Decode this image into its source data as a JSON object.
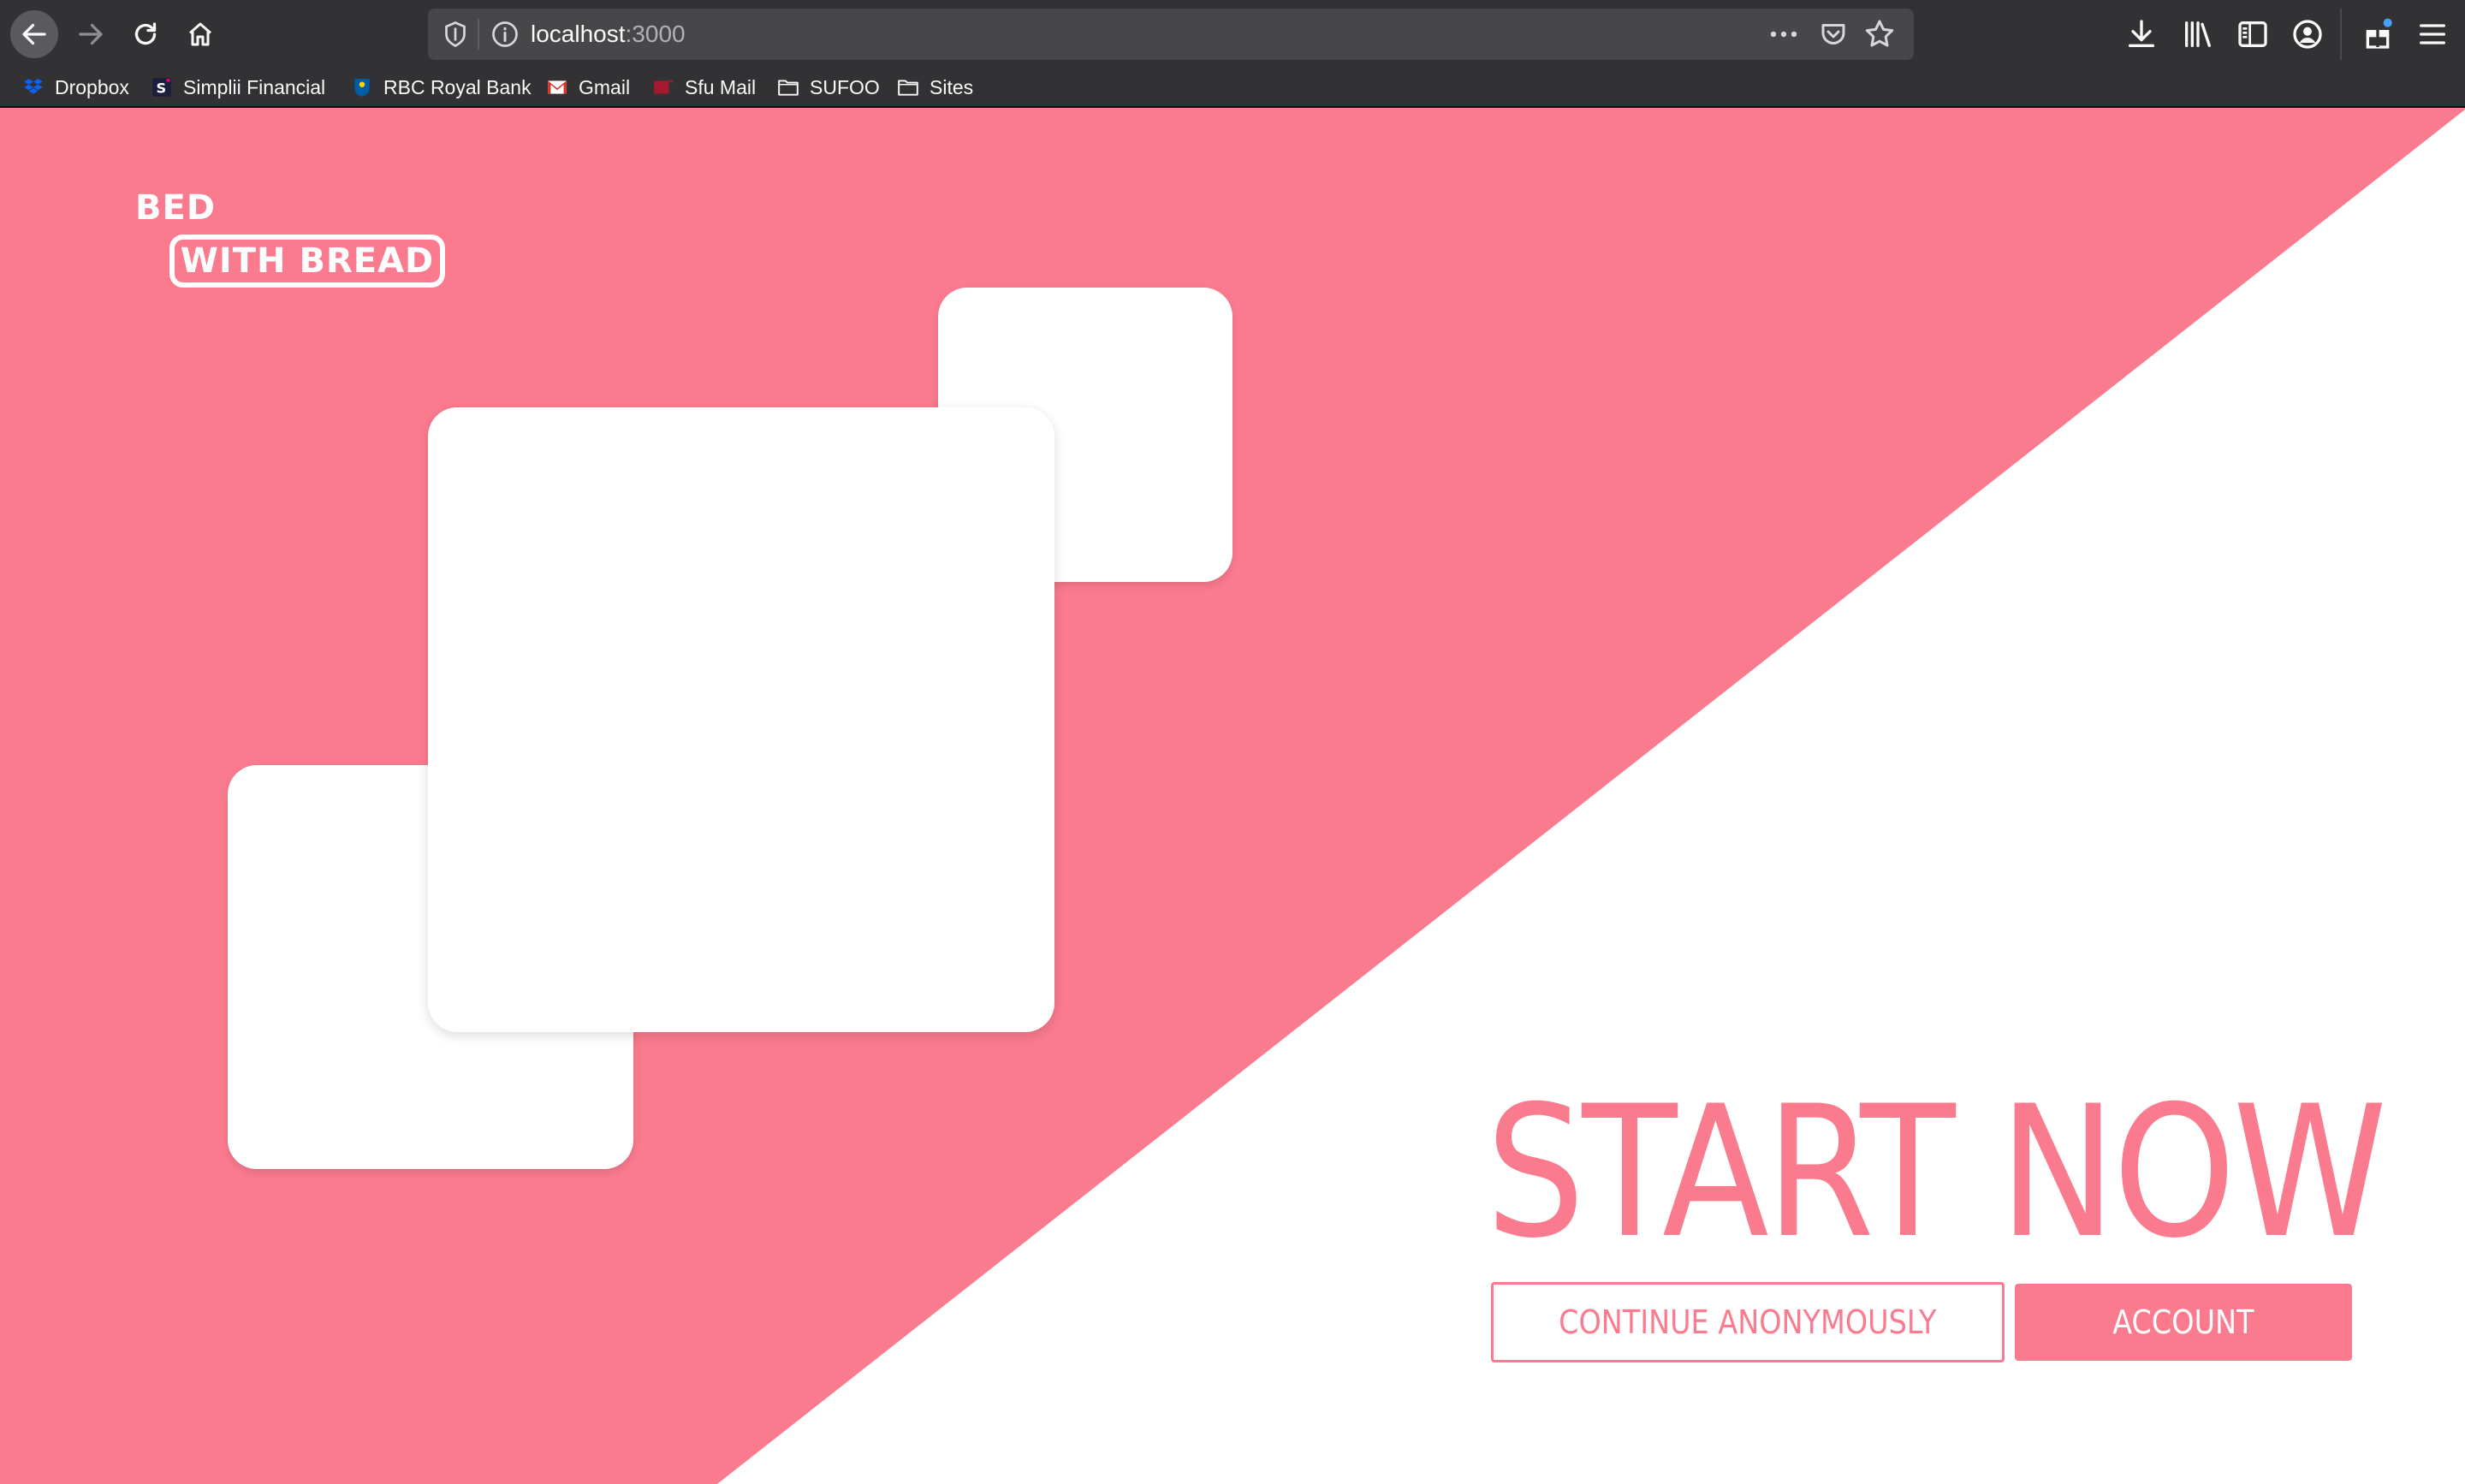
{
  "browser": {
    "url_host": "localhost",
    "url_port": ":3000",
    "bookmarks": [
      {
        "label": "Dropbox",
        "icon": "dropbox-icon"
      },
      {
        "label": "Simplii Financial",
        "icon": "simplii-icon"
      },
      {
        "label": "RBC Royal Bank",
        "icon": "rbc-icon"
      },
      {
        "label": "Gmail",
        "icon": "gmail-icon"
      },
      {
        "label": "Sfu Mail",
        "icon": "sfu-icon"
      },
      {
        "label": "SUFOO",
        "icon": "folder-icon"
      },
      {
        "label": "Sites",
        "icon": "folder-icon"
      }
    ]
  },
  "logo": {
    "top": "BED",
    "bottom": "WITH BREAD"
  },
  "hero": {
    "headline": "START NOW",
    "continue_label": "CONTINUE ANONYMOUSLY",
    "account_label": "ACCOUNT"
  },
  "colors": {
    "accent": "#fb7b8e",
    "chrome": "#323234",
    "background": "#ffffff"
  }
}
